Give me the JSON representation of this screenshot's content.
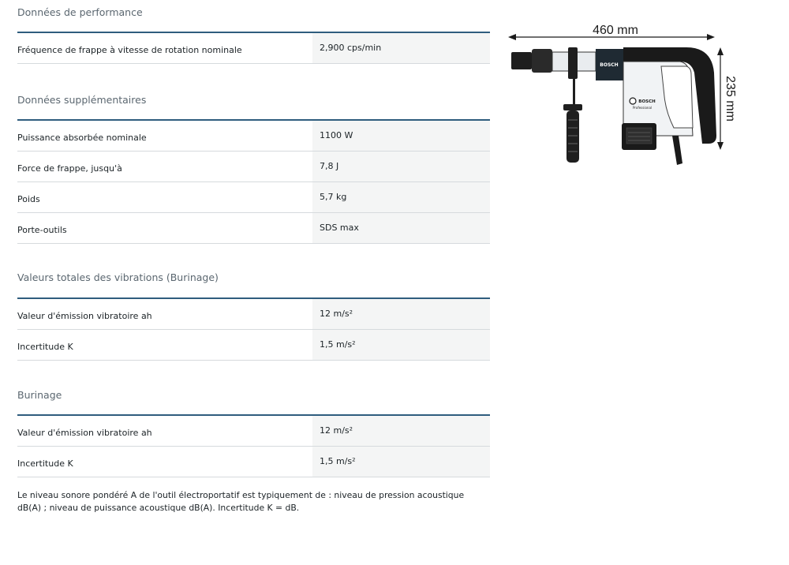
{
  "sections": [
    {
      "title": "Données de performance",
      "rows": [
        {
          "label": "Fréquence de frappe à vitesse de rotation nominale",
          "value": "2,900 cps/min"
        }
      ]
    },
    {
      "title": "Données supplémentaires",
      "rows": [
        {
          "label": "Puissance absorbée nominale",
          "value": "1100 W"
        },
        {
          "label": "Force de frappe, jusqu'à",
          "value": "7,8 J"
        },
        {
          "label": "Poids",
          "value": "5,7 kg"
        },
        {
          "label": "Porte-outils",
          "value": "SDS max"
        }
      ]
    },
    {
      "title": "Valeurs totales des vibrations (Burinage)",
      "rows": [
        {
          "label": "Valeur d'émission vibratoire ah",
          "value": "12 m/s²"
        },
        {
          "label": "Incertitude K",
          "value": "1,5 m/s²"
        }
      ]
    },
    {
      "title": "Burinage",
      "rows": [
        {
          "label": "Valeur d'émission vibratoire ah",
          "value": "12 m/s²"
        },
        {
          "label": "Incertitude K",
          "value": "1,5 m/s²"
        }
      ]
    }
  ],
  "note": "Le niveau sonore pondéré A de l'outil électroportatif est typiquement de : niveau de pression acoustique dB(A) ; niveau de puissance acoustique dB(A). Incertitude K = dB.",
  "figure": {
    "length_label": "460 mm",
    "height_label": "235 mm",
    "brand_label": "BOSCH",
    "housing_brand_label": "BOSCH",
    "product_label": "Professional"
  }
}
